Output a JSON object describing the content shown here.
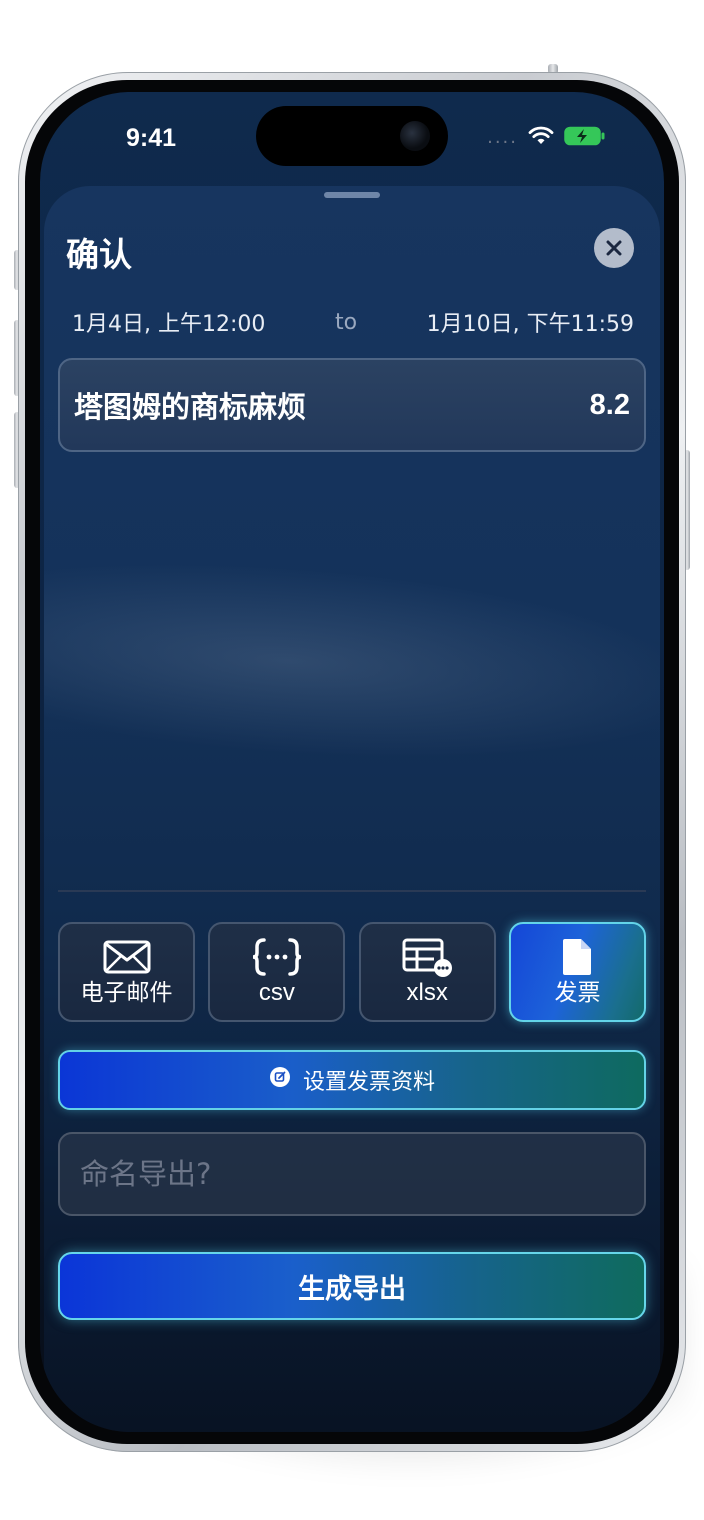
{
  "status_bar": {
    "time": "9:41",
    "signal": "....",
    "wifi_icon": "wifi-icon",
    "battery_icon": "battery-charging-icon"
  },
  "sheet": {
    "title": "确认",
    "close_icon": "close-icon",
    "date_range": {
      "start": "1月4日, 上午12:00",
      "separator": "to",
      "end": "1月10日, 下午11:59"
    },
    "items": [
      {
        "name": "塔图姆的商标麻烦",
        "value": "8.2"
      }
    ]
  },
  "export_formats": [
    {
      "label": "电子邮件",
      "icon": "envelope-icon",
      "selected": false
    },
    {
      "label": "csv",
      "icon": "json-braces-icon",
      "selected": false
    },
    {
      "label": "xlsx",
      "icon": "spreadsheet-icon",
      "selected": false
    },
    {
      "label": "发票",
      "icon": "document-icon",
      "selected": true
    }
  ],
  "invoice_settings_button": {
    "label": "设置发票资料",
    "icon": "edit-icon"
  },
  "export_name_input": {
    "value": "",
    "placeholder": "命名导出?"
  },
  "generate_button": {
    "label": "生成导出"
  },
  "colors": {
    "accent_start": "#0b35d8",
    "accent_end": "#0f6b5d",
    "accent_border": "#66d6ea",
    "sheet_background": "#14325a",
    "close_button": "#b3bccb"
  }
}
